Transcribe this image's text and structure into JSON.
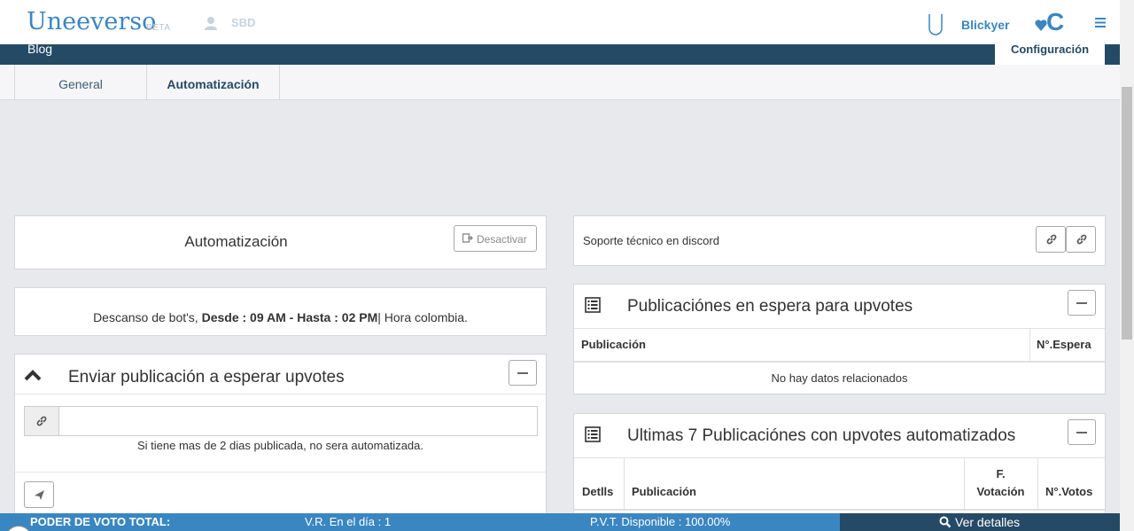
{
  "header": {
    "logo": "Uneeverso",
    "beta": "BETA",
    "currency": "SBD",
    "username": "Blickyer",
    "icons": [
      "user-icon",
      "u-logo-icon",
      "heart-c-icon",
      "hamburger-icon"
    ]
  },
  "nav": {
    "blog": "Blog",
    "config": "Configuración"
  },
  "tabs": [
    {
      "label": "General"
    },
    {
      "label": "Automatización"
    }
  ],
  "left": {
    "auto_title": "Automatización",
    "deactivate": "Desactivar",
    "rest_prefix": "Descanso de bot's, ",
    "rest_bold": "Desde : 09 AM - Hasta : 02 PM",
    "rest_suffix": "| Hora colombia.",
    "send_title": "Enviar publicación a esperar upvotes",
    "input_value": "",
    "hint": "Si tiene mas de 2 dias publicada, no sera automatizada."
  },
  "right": {
    "discord": "Soporte técnico en discord",
    "wait_title": "Publicaciónes en espera para upvotes",
    "wait_columns": [
      "Publicación",
      "N°.Espera"
    ],
    "wait_empty": "No hay datos relacionados",
    "last_title": "Ultimas 7 Publicaciónes con upvotes automatizados",
    "last_columns": [
      "Detlls",
      "Publicación",
      "F.",
      "Votación",
      "N°.Votos"
    ]
  },
  "footer": {
    "power": "PODER DE VOTO TOTAL:",
    "vr": "V.R. En el día : 1",
    "pvt": "P.V.T. Disponible : 100.00%",
    "details": "Ver detalles"
  },
  "colors": {
    "brand": "#3a86c0",
    "navy": "#254a66",
    "bg": "#e8e9ed"
  }
}
